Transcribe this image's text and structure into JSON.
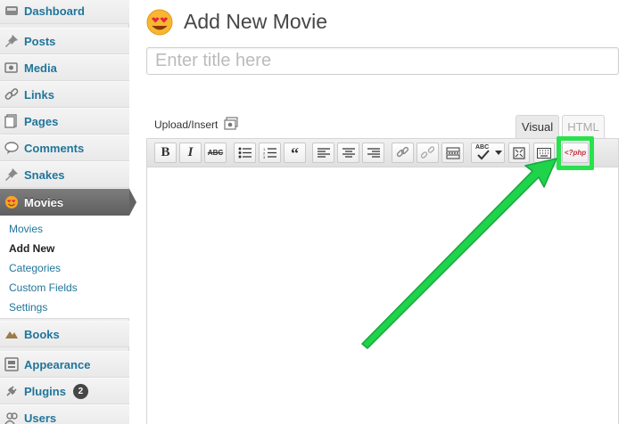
{
  "sidebar": {
    "dashboard": "Dashboard",
    "posts": "Posts",
    "media": "Media",
    "links": "Links",
    "pages": "Pages",
    "comments": "Comments",
    "snakes": "Snakes",
    "movies": "Movies",
    "submenu": [
      "Movies",
      "Add New",
      "Categories",
      "Custom Fields",
      "Settings"
    ],
    "books": "Books",
    "appearance": "Appearance",
    "plugins": "Plugins",
    "plugins_badge": "2",
    "users": "Users"
  },
  "page": {
    "title": "Add New Movie",
    "title_placeholder": "Enter title here",
    "upload_insert": "Upload/Insert"
  },
  "editor": {
    "tab_visual": "Visual",
    "tab_html": "HTML",
    "bold_label": "B",
    "italic_label": "I",
    "strike_label": "ABC",
    "quote_label": "“",
    "spellcheck_label": "ABC",
    "php_label": "<?php"
  },
  "colors": {
    "link": "#21759b",
    "highlight": "#26e34b",
    "current_menu": "#6b6b6b"
  }
}
